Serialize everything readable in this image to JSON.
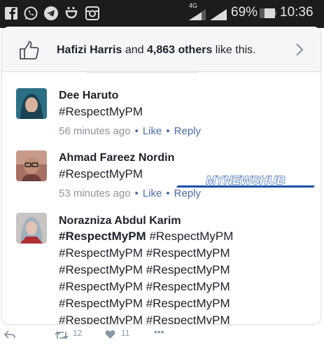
{
  "status_bar": {
    "network": "4G",
    "battery": "69%",
    "time": "10:36",
    "left_icons": [
      "facebook-icon",
      "whatsapp-icon",
      "telegram-icon",
      "umbrella-icon",
      "instagram-icon"
    ]
  },
  "likes": {
    "name": "Hafizi Harris",
    "conj": " and ",
    "count": "4,863 others",
    "suffix": " like this."
  },
  "comments": [
    {
      "author": "Dee Haruto",
      "text": "#RespectMyPM",
      "time": "56 minutes ago",
      "like": "Like",
      "reply": "Reply"
    },
    {
      "author": "Ahmad Fareez Nordin",
      "text": "#RespectMyPM",
      "time": "53 minutes ago",
      "like": "Like",
      "reply": "Reply"
    },
    {
      "author": "Norazniza Abdul Karim",
      "lines": [
        "#RespectMyPM #RespectMyPM",
        "#RespectMyPM #RespectMyPM",
        "#RespectMyPM #RespectMyPM",
        "#RespectMyPM #RespectMyPM",
        "#RespectMyPM #RespectMyPM",
        "#RespectMyPM #RespectMyPM"
      ]
    }
  ],
  "watermark": "MYNEWSHUB",
  "tweet_actions": {
    "retweets": "12",
    "likes": "11",
    "more": "•••"
  },
  "colors": {
    "link": "#4b6aa8",
    "meta": "#90949c",
    "text": "#1d2129",
    "watermark": "#1a4fa8"
  }
}
